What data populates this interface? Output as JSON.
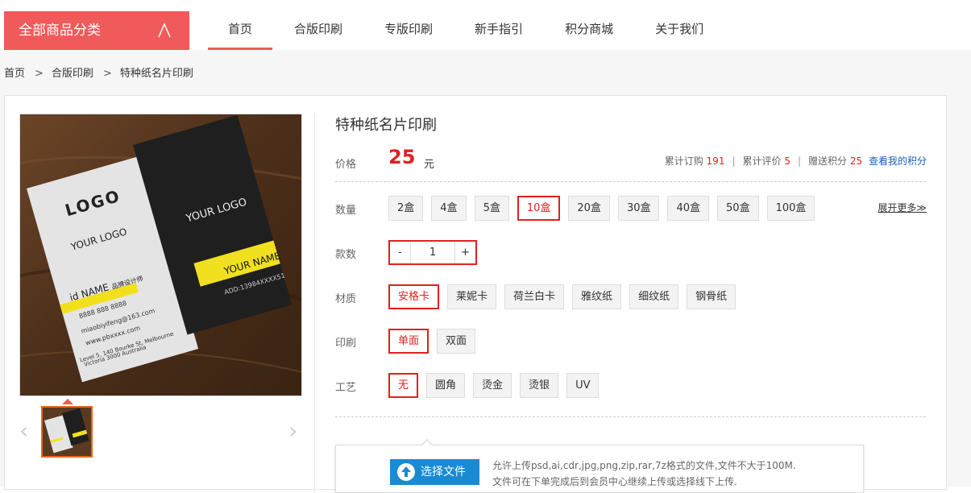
{
  "header": {
    "all_categories": "全部商品分类",
    "nav": [
      {
        "label": "首页",
        "active": true
      },
      {
        "label": "合版印刷",
        "active": false
      },
      {
        "label": "专版印刷",
        "active": false
      },
      {
        "label": "新手指引",
        "active": false
      },
      {
        "label": "积分商城",
        "active": false
      },
      {
        "label": "关于我们",
        "active": false
      }
    ]
  },
  "breadcrumb": [
    "首页",
    "合版印刷",
    "特种纸名片印刷"
  ],
  "breadcrumb_sep": ">",
  "product": {
    "title": "特种纸名片印刷",
    "price_label": "价格",
    "price": "25",
    "price_unit": "元",
    "stats": {
      "orders_label": "累计订购",
      "orders": "191",
      "reviews_label": "累计评价",
      "reviews": "5",
      "points_label": "赠送积分",
      "points": "25",
      "my_points_link": "查看我的积分"
    },
    "quantity_label": "数量",
    "quantity_options": [
      "2盒",
      "4盒",
      "5盒",
      "10盒",
      "20盒",
      "30盒",
      "40盒",
      "50盒",
      "100盒"
    ],
    "quantity_selected": "10盒",
    "expand_more": "展开更多≫",
    "count_label": "款数",
    "count_minus": "-",
    "count_value": "1",
    "count_plus": "+",
    "material_label": "材质",
    "material_options": [
      "安格卡",
      "莱妮卡",
      "荷兰白卡",
      "雅纹纸",
      "细纹纸",
      "钢骨纸"
    ],
    "material_selected": "安格卡",
    "print_label": "印刷",
    "print_options": [
      "单面",
      "双面"
    ],
    "print_selected": "单面",
    "craft_label": "工艺",
    "craft_options": [
      "无",
      "圆角",
      "烫金",
      "烫银",
      "UV"
    ],
    "craft_selected": "无"
  },
  "gallery": {
    "card_white": {
      "logo": "LOGO",
      "your_logo": "YOUR LOGO",
      "name": "id NAME",
      "sub": "品牌设计师",
      "phone": "8888 888 8888",
      "email": "miaobiyifeng@163.com",
      "web": "www.pbxxxx.com",
      "addr1": "Level 5, 140 Bourke St, Melbourne",
      "addr2": "Victoria 3000 Australia"
    },
    "card_black": {
      "your_logo": "YOUR LOGO",
      "name": "YOUR NAME",
      "add": "ADD:13984XXXX51"
    },
    "arrow_prev": "‹",
    "arrow_next": "›"
  },
  "upload": {
    "button": "选择文件",
    "line1": "允许上传psd,ai,cdr,jpg,png,zip,rar,7z格式的文件,文件不大于100M.",
    "line2": "文件可在下单完成后到会员中心继续上传或选择线下上传."
  },
  "colors": {
    "accent": "#f05a5a",
    "price_red": "#e02020",
    "link_blue": "#1a5fb4",
    "upload_blue": "#1a8ad1"
  }
}
